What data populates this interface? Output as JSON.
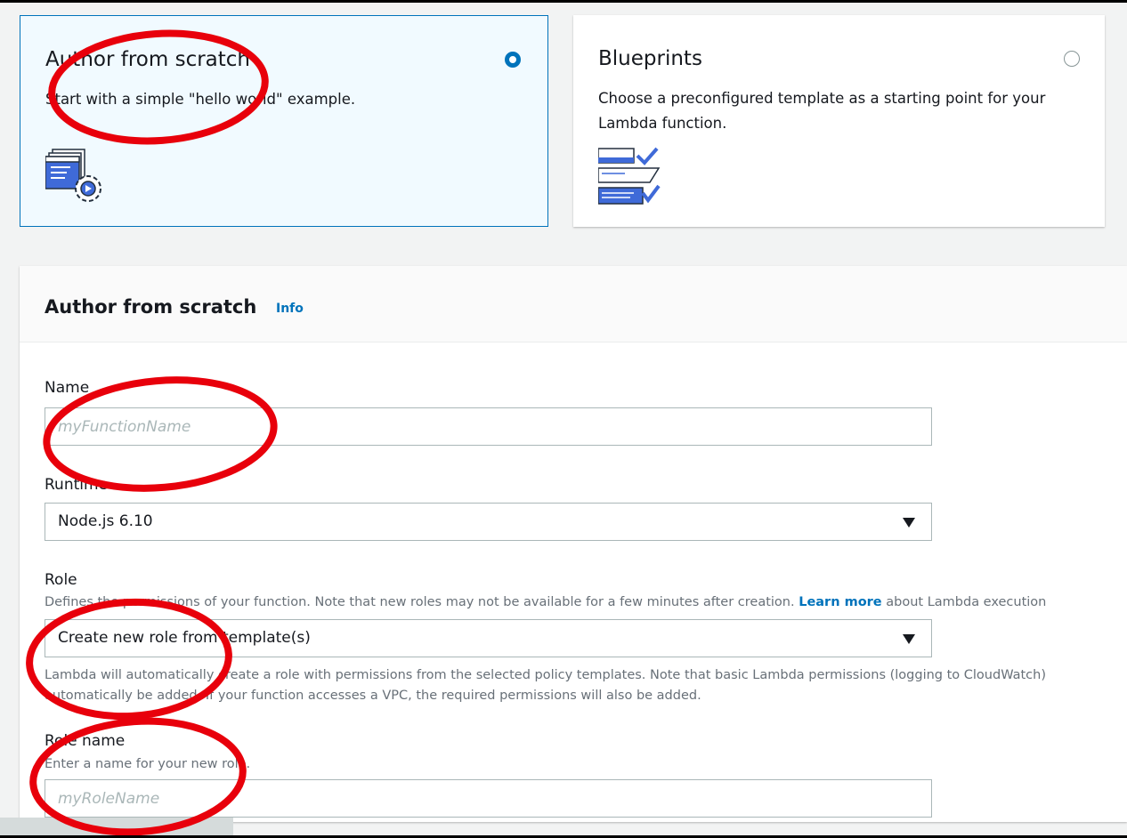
{
  "option_cards": [
    {
      "title": "Author from scratch",
      "description": "Start with a simple \"hello world\" example.",
      "selected": true,
      "icon": "code-gear-icon"
    },
    {
      "title": "Blueprints",
      "description": "Choose a preconfigured template as a starting point for your Lambda function.",
      "selected": false,
      "icon": "checklist-icon"
    }
  ],
  "form": {
    "title": "Author from scratch",
    "info_link": "Info",
    "name": {
      "label": "Name",
      "placeholder": "myFunctionName",
      "value": ""
    },
    "runtime": {
      "label": "Runtime",
      "selected": "Node.js 6.10"
    },
    "role": {
      "label": "Role",
      "hint_prefix": "Defines the permissions of your function. Note that new roles may not be available for a few minutes after creation.",
      "hint_link": "Learn more",
      "hint_suffix": "about Lambda execution",
      "selected": "Create new role from template(s)",
      "help_line1": "Lambda will automatically create a role with permissions from the selected policy templates. Note that basic Lambda permissions (logging to CloudWatch)",
      "help_line2": "automatically be added. If your function accesses a VPC, the required permissions will also be added."
    },
    "role_name": {
      "label": "Role name",
      "hint": "Enter a name for your new role.",
      "placeholder": "myRoleName",
      "value": ""
    }
  },
  "colors": {
    "accent": "#0073bb",
    "annotation": "#e8000b",
    "selected_card_bg": "#f1faff"
  }
}
